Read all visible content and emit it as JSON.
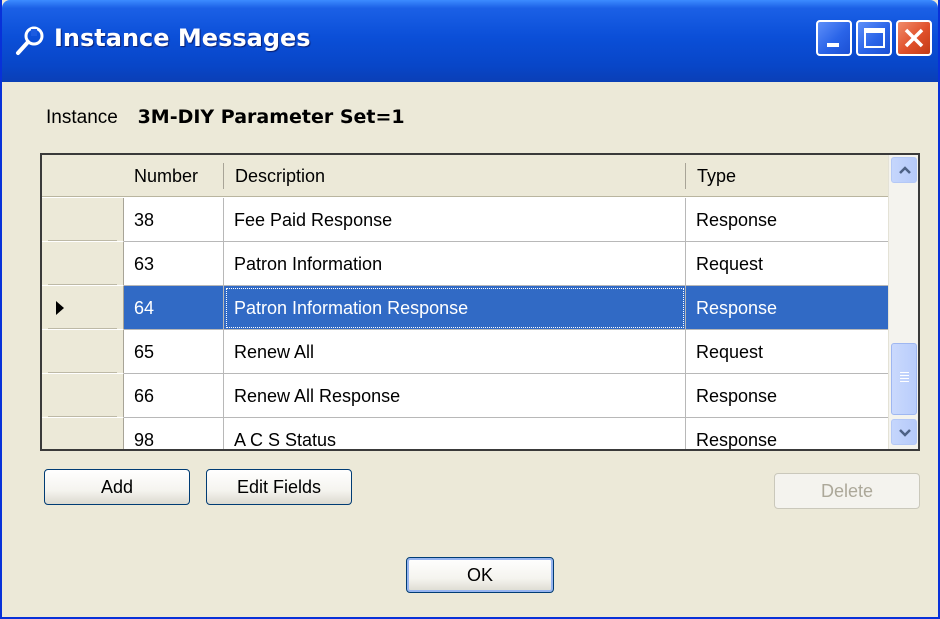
{
  "window": {
    "title": "Instance Messages",
    "icon": "wrench-icon",
    "accent": "#0b4fd8"
  },
  "instance": {
    "label": "Instance",
    "value": "3M-DIY Parameter Set=1"
  },
  "grid": {
    "columns": [
      "Number",
      "Description",
      "Type"
    ],
    "rows": [
      {
        "number": "38",
        "description": "Fee Paid Response",
        "type": "Response",
        "selected": false
      },
      {
        "number": "63",
        "description": "Patron Information",
        "type": "Request",
        "selected": false
      },
      {
        "number": "64",
        "description": "Patron Information Response",
        "type": "Response",
        "selected": true
      },
      {
        "number": "65",
        "description": "Renew All",
        "type": "Request",
        "selected": false
      },
      {
        "number": "66",
        "description": "Renew All Response",
        "type": "Response",
        "selected": false
      },
      {
        "number": "98",
        "description": "A C S Status",
        "type": "Response",
        "selected": false
      }
    ],
    "selection_color": "#316ac5"
  },
  "buttons": {
    "add": "Add",
    "edit_fields": "Edit Fields",
    "delete": "Delete",
    "ok": "OK"
  }
}
